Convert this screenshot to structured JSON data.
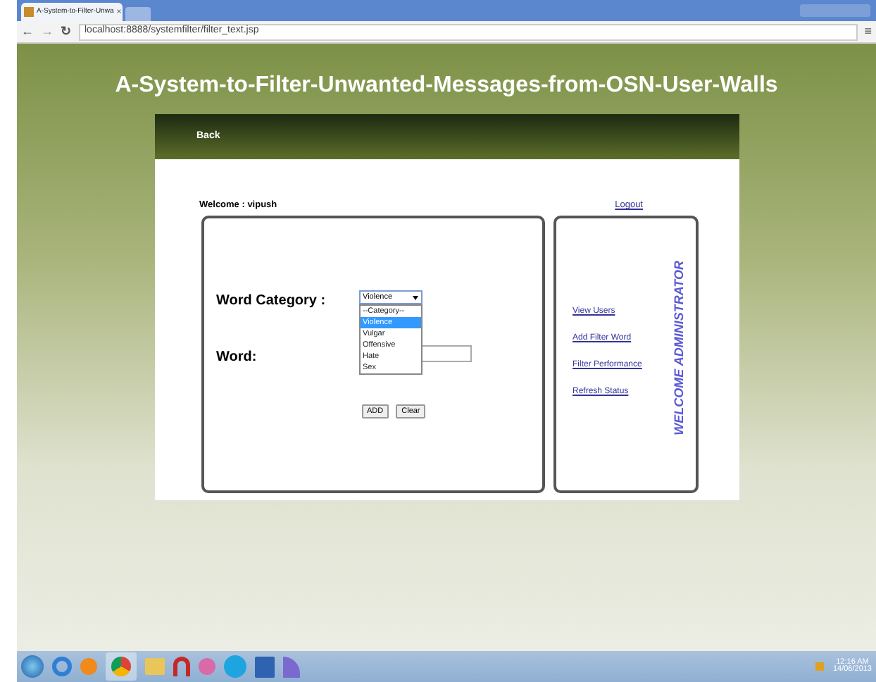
{
  "browser": {
    "tab_title": "A-System-to-Filter-Unwa",
    "tab_close": "×",
    "nav": [
      "←",
      "→",
      "↻"
    ],
    "address": "localhost:8888/systemfilter/filter_text.jsp",
    "menu": "≡"
  },
  "page": {
    "title": "A-System-to-Filter-Unwanted-Messages-from-OSN-User-Walls",
    "back": "Back",
    "welcome": "Welcome : vipush",
    "logout": "Logout",
    "form": {
      "category_label": "Word Category :",
      "category_value": "Violence",
      "options": [
        {
          "label": "--Category--",
          "selected": false
        },
        {
          "label": "Violence",
          "selected": true
        },
        {
          "label": "Vulgar",
          "selected": false
        },
        {
          "label": "Offensive",
          "selected": false
        },
        {
          "label": "Hate",
          "selected": false
        },
        {
          "label": "Sex",
          "selected": false
        }
      ],
      "word_label": "Word:",
      "buttons": [
        "ADD",
        "Clear"
      ]
    },
    "menu": [
      "View Users",
      "Add Filter Word",
      "Filter Performance",
      "Refresh Status"
    ],
    "stamp": "WELCOME ADMINISTRATOR"
  },
  "taskbar": {
    "time": "12:16 AM",
    "date": "14/06/2013"
  }
}
